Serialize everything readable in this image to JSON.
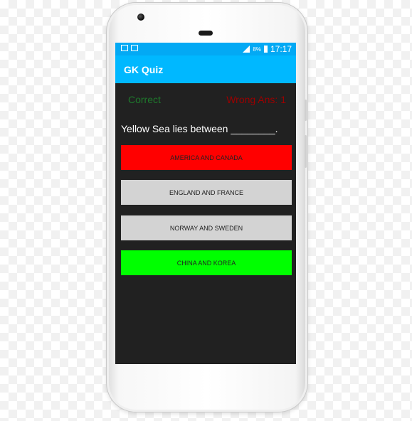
{
  "status_bar": {
    "battery": "8%",
    "time": "17:17"
  },
  "app_bar": {
    "title": "GK Quiz"
  },
  "score": {
    "correct_label": "Correct",
    "wrong_label": "Wrong Ans: 1"
  },
  "question": {
    "text": "Yellow Sea lies between ________."
  },
  "options": [
    {
      "label": "AMERICA AND CANADA",
      "state": "wrong",
      "color": "#ff0000"
    },
    {
      "label": "ENGLAND AND FRANCE",
      "state": "neutral",
      "color": "#d3d3d3"
    },
    {
      "label": "NORWAY AND SWEDEN",
      "state": "neutral",
      "color": "#d3d3d3"
    },
    {
      "label": "CHINA AND KOREA",
      "state": "correct",
      "color": "#00ff00"
    }
  ],
  "colors": {
    "accent": "#00b8ff",
    "status_bar": "#03a9f4",
    "screen_bg": "#212121",
    "correct_text": "#1e7a2c",
    "wrong_text": "#9b0000"
  }
}
